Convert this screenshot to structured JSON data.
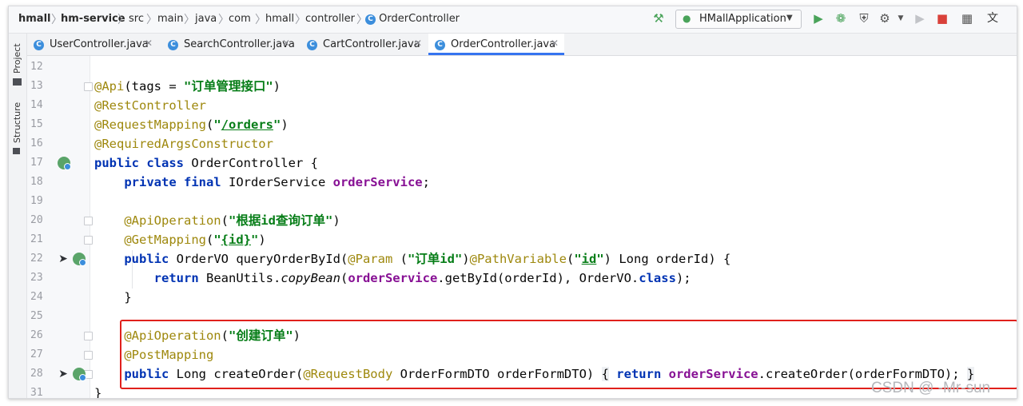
{
  "breadcrumb": [
    "hmall",
    "hm-service",
    "src",
    "main",
    "java",
    "com",
    "hmall",
    "controller",
    "OrderController"
  ],
  "run_config": {
    "label": "HMallApplication"
  },
  "tool_strip": {
    "project": "Project",
    "structure": "Structure"
  },
  "tabs": [
    {
      "label": "UserController.java"
    },
    {
      "label": "SearchController.java"
    },
    {
      "label": "CartController.java"
    },
    {
      "label": "OrderController.java",
      "active": true
    }
  ],
  "editor": {
    "line_numbers": [
      "12",
      "13",
      "14",
      "15",
      "16",
      "17",
      "18",
      "19",
      "20",
      "21",
      "22",
      "23",
      "24",
      "25",
      "26",
      "27",
      "28",
      "31"
    ]
  },
  "code": {
    "l13": {
      "a": "@Api",
      "b": "(tags = ",
      "c": "\"订单管理接口\"",
      "d": ")"
    },
    "l14": {
      "a": "@RestController"
    },
    "l15": {
      "a": "@RequestMapping",
      "b": "(",
      "c": "\"",
      "d": "/orders",
      "e": "\"",
      "f": ")"
    },
    "l16": {
      "a": "@RequiredArgsConstructor"
    },
    "l17": {
      "a": "public class",
      "b": " OrderController {"
    },
    "l18": {
      "a": "    ",
      "b": "private final",
      "c": " IOrderService ",
      "d": "orderService",
      "e": ";"
    },
    "l20": {
      "a": "    ",
      "b": "@ApiOperation",
      "c": "(",
      "d": "\"根据id查询订单\"",
      "e": ")"
    },
    "l21": {
      "a": "    ",
      "b": "@GetMapping",
      "c": "(",
      "d": "\"",
      "e": "{id}",
      "f": "\"",
      "g": ")"
    },
    "l22": {
      "a": "    ",
      "b": "public",
      "c": " OrderVO queryOrderById(",
      "d": "@Param",
      "e": " (",
      "f": "\"订单id\"",
      "g": ")",
      "h": "@PathVariable",
      "i": "(",
      "j": "\"",
      "k": "id",
      "l": "\"",
      "m": ") Long orderId) {"
    },
    "l23": {
      "a": "        ",
      "b": "return",
      "c": " BeanUtils.",
      "d": "copyBean",
      "e": "(",
      "f": "orderService",
      "g": ".getById(orderId), OrderVO.",
      "h": "class",
      "i": ");"
    },
    "l24": {
      "a": "    }"
    },
    "l26": {
      "a": "    ",
      "b": "@ApiOperation",
      "c": "(",
      "d": "\"创建订单\"",
      "e": ")"
    },
    "l27": {
      "a": "    ",
      "b": "@PostMapping"
    },
    "l28": {
      "a": "    ",
      "b": "public",
      "c": " Long createOrder(",
      "d": "@RequestBody",
      "e": " OrderFormDTO orderFormDTO) ",
      "f": "{",
      "g": " ",
      "h": "return",
      "i": " ",
      "j": "orderService",
      "k": ".createOrder(orderFormDTO); ",
      "l": "}"
    },
    "l31": {
      "a": "}"
    }
  },
  "watermark": "CSDN @ -Mr-sun",
  "colors": {
    "annotation": "#9e880d",
    "keyword": "#0033b3",
    "string": "#067d17",
    "field": "#871094",
    "highlight_box": "#e0201c",
    "active_tab": "#3574f0"
  }
}
